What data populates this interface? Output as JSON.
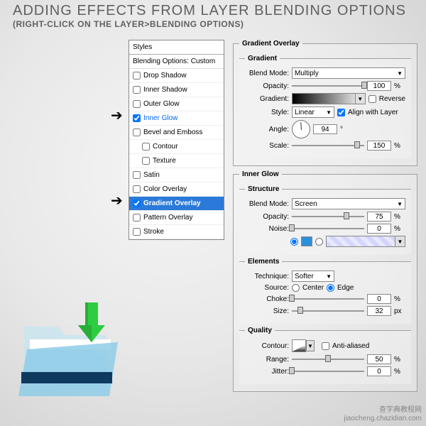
{
  "header": {
    "title": "ADDING EFFECTS FROM LAYER BLENDING OPTIONS",
    "subtitle": "(RIGHT-CLICK ON THE LAYER>BLENDING OPTIONS)"
  },
  "styles": {
    "heading": "Styles",
    "blending": "Blending Options: Custom",
    "items": [
      {
        "label": "Drop Shadow",
        "checked": false
      },
      {
        "label": "Inner Shadow",
        "checked": false
      },
      {
        "label": "Outer Glow",
        "checked": false
      },
      {
        "label": "Inner Glow",
        "checked": true,
        "highlight": "blue"
      },
      {
        "label": "Bevel and Emboss",
        "checked": false
      },
      {
        "label": "Contour",
        "checked": false,
        "indent": true
      },
      {
        "label": "Texture",
        "checked": false,
        "indent": true
      },
      {
        "label": "Satin",
        "checked": false
      },
      {
        "label": "Color Overlay",
        "checked": false
      },
      {
        "label": "Gradient Overlay",
        "checked": true,
        "highlight": "selected"
      },
      {
        "label": "Pattern Overlay",
        "checked": false
      },
      {
        "label": "Stroke",
        "checked": false
      }
    ]
  },
  "gradient_overlay": {
    "legend": "Gradient Overlay",
    "group": "Gradient",
    "blend_mode_lbl": "Blend Mode:",
    "blend_mode_val": "Multiply",
    "opacity_lbl": "Opacity:",
    "opacity_val": "100",
    "gradient_lbl": "Gradient:",
    "reverse_lbl": "Reverse",
    "style_lbl": "Style:",
    "style_val": "Linear",
    "align_lbl": "Align with Layer",
    "angle_lbl": "Angle:",
    "angle_val": "94",
    "deg": "°",
    "scale_lbl": "Scale:",
    "scale_val": "150",
    "pct": "%"
  },
  "inner_glow": {
    "legend": "Inner Glow",
    "structure": "Structure",
    "blend_mode_lbl": "Blend Mode:",
    "blend_mode_val": "Screen",
    "opacity_lbl": "Opacity:",
    "opacity_val": "75",
    "noise_lbl": "Noise:",
    "noise_val": "0",
    "elements": "Elements",
    "technique_lbl": "Technique:",
    "technique_val": "Softer",
    "source_lbl": "Source:",
    "center_lbl": "Center",
    "edge_lbl": "Edge",
    "choke_lbl": "Choke:",
    "choke_val": "0",
    "size_lbl": "Size:",
    "size_val": "32",
    "px": "px",
    "quality": "Quality",
    "contour_lbl": "Contour:",
    "aa_lbl": "Anti-aliased",
    "range_lbl": "Range:",
    "range_val": "50",
    "jitter_lbl": "Jitter:",
    "jitter_val": "0",
    "pct": "%"
  },
  "watermark": {
    "line1": "查字典教程网",
    "line2": "jiaocheng.chazidian.com"
  }
}
